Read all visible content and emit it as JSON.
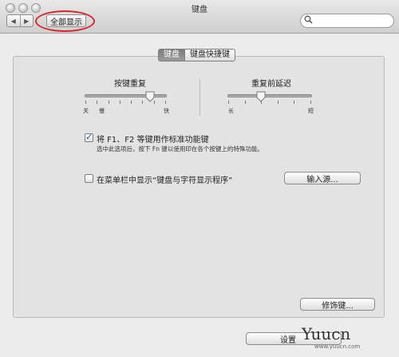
{
  "window": {
    "title": "键盘"
  },
  "toolbar": {
    "back_glyph": "◀",
    "forward_glyph": "▶",
    "show_all_label": "全部显示",
    "search_placeholder": ""
  },
  "tabs": [
    {
      "label": "键盘",
      "active": true
    },
    {
      "label": "键盘快捷键",
      "active": false
    }
  ],
  "key_repeat": {
    "title": "按键重复",
    "labels": {
      "off": "关",
      "slow": "慢",
      "fast": "快"
    },
    "value_fraction": 0.8
  },
  "delay_until_repeat": {
    "title": "重复前延迟",
    "labels": {
      "long": "长",
      "short": "短"
    },
    "value_fraction": 0.4
  },
  "function_keys": {
    "checked": true,
    "label": "将 F1、F2 等键用作标准功能键",
    "note": "选中此选项后，按下 Fn 键以使用印在各个按键上的特殊功能。"
  },
  "menubar_viewer": {
    "checked": false,
    "label": "在菜单栏中显示“键盘与字符显示程序”"
  },
  "buttons": {
    "input_sources": "输入源...",
    "modifier_keys": "修饰键...",
    "setup_bluetooth": "设置"
  },
  "watermark": {
    "text": "Yuucn",
    "sub": "www.yuucn.com"
  },
  "colors": {
    "highlight_ring": "#d9262c",
    "check_blue": "#1b53b3"
  }
}
